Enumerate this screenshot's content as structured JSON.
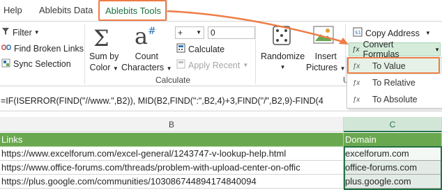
{
  "tabs": [
    {
      "label": "Help"
    },
    {
      "label": "Ablebits Data"
    },
    {
      "label": "Ablebits Tools"
    }
  ],
  "ribbon": {
    "filter_label": "Filter",
    "find_broken_links_label": "Find Broken Links",
    "sync_selection_label": "Sync Selection",
    "sum_by_color_line1": "Sum by",
    "sum_by_color_line2": "Color",
    "count_characters_line1": "Count",
    "count_characters_line2": "Characters",
    "operator_value": "+",
    "number_value": "0",
    "calculate_label": "Calculate",
    "apply_recent_label": "Apply Recent",
    "calculate_group_label": "Calculate",
    "randomize_label": "Randomize",
    "insert_pictures_line1": "Insert",
    "insert_pictures_line2": "Pictures",
    "group_label_partial": "U",
    "copy_address_label": "Copy Address",
    "convert_formulas_label": "Convert Formulas"
  },
  "convert_menu": {
    "items": [
      {
        "label": "To Value",
        "icon": "fx-to-value-icon"
      },
      {
        "label": "To Relative",
        "icon": "fx-to-relative-icon"
      },
      {
        "label": "To Absolute",
        "icon": "fx-to-absolute-icon"
      }
    ]
  },
  "formula_bar": {
    "text": "=IF(ISERROR(FIND(\"//www.\",B2)), MID(B2,FIND(\":\",B2,4)+3,FIND(\"/\",B2,9)-FIND(4"
  },
  "sheet": {
    "col_b_header": "B",
    "col_c_header": "C",
    "header_row": {
      "links": "Links",
      "domain": "Domain"
    },
    "rows": [
      {
        "link": "https://www.excelforum.com/excel-general/1243747-v-lookup-help.html",
        "domain": "excelforum.com"
      },
      {
        "link": "https://www.office-forums.com/threads/problem-with-upload-center-on-offic",
        "domain": "office-forums.com"
      },
      {
        "link": "https://plus.google.com/communities/103086744894174840094",
        "domain": "plus.google.com"
      }
    ]
  },
  "colors": {
    "accent_orange": "#ee7c45",
    "excel_green": "#217346",
    "header_green": "#6aa84f"
  }
}
